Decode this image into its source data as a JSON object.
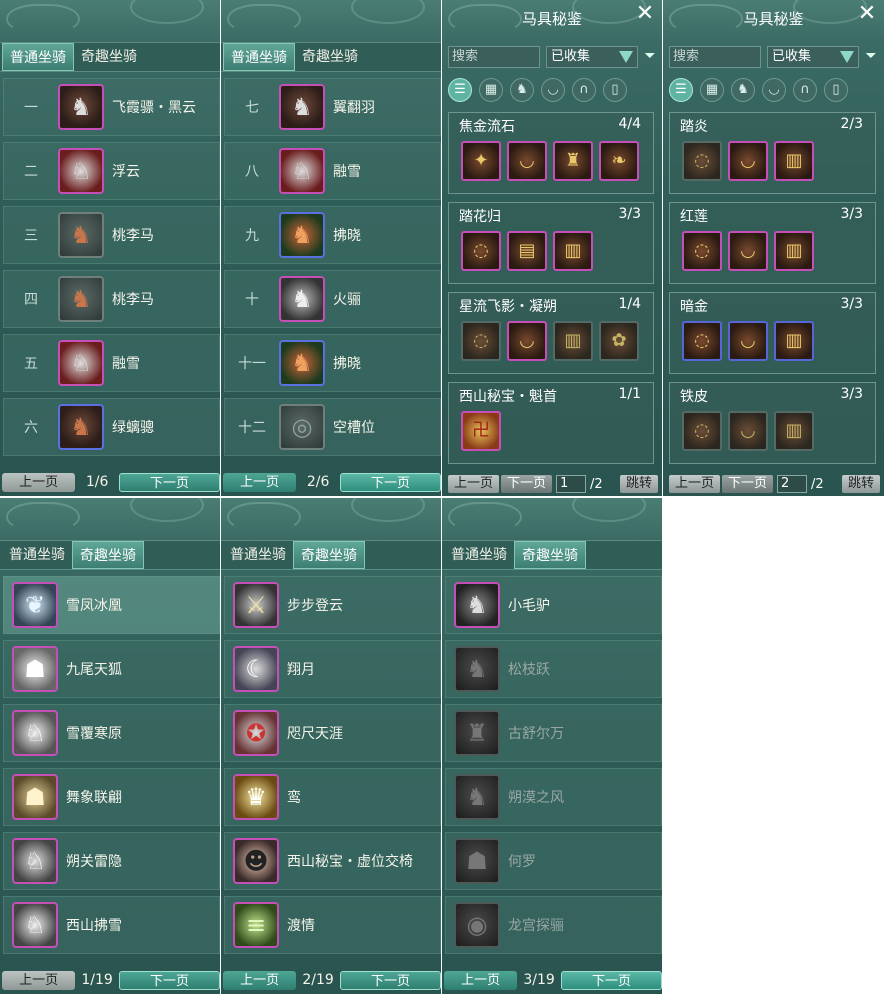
{
  "colors": {
    "panel_bg": "#2f5d57",
    "tab_active": "#4b9485",
    "rare_border": "#c44fb6",
    "epic_border": "#5a6fe0",
    "next_button": "#3aa08f"
  },
  "tabs": {
    "normal": "普通坐骑",
    "fun": "奇趣坐骑"
  },
  "pager": {
    "prev": "上一页",
    "next": "下一页"
  },
  "normal_page1": {
    "page": "1/6",
    "items": [
      {
        "num": "一",
        "name": "飞霞骠・黑云",
        "icon": "black-horse-icon"
      },
      {
        "num": "二",
        "name": "浮云",
        "icon": "white-horse-icon"
      },
      {
        "num": "三",
        "name": "桃李马",
        "icon": "brown-horse-icon"
      },
      {
        "num": "四",
        "name": "桃李马",
        "icon": "brown-horse-icon"
      },
      {
        "num": "五",
        "name": "融雪",
        "icon": "white-horse-icon"
      },
      {
        "num": "六",
        "name": "绿螭骢",
        "icon": "brown-horse-icon"
      }
    ]
  },
  "normal_page2": {
    "page": "2/6",
    "items": [
      {
        "num": "七",
        "name": "翼翻羽",
        "icon": "black-horse-icon"
      },
      {
        "num": "八",
        "name": "融雪",
        "icon": "white-horse-icon"
      },
      {
        "num": "九",
        "name": "拂晓",
        "icon": "chestnut-horse-icon"
      },
      {
        "num": "十",
        "name": "火骊",
        "icon": "gray-horse-icon"
      },
      {
        "num": "十一",
        "name": "拂晓",
        "icon": "chestnut-horse-icon"
      },
      {
        "num": "十二",
        "name": "空槽位",
        "icon": "empty-slot-icon"
      }
    ]
  },
  "catalog_common": {
    "title": "马具秘鉴",
    "search_placeholder": "搜索",
    "filter_value": "已收集",
    "page_total": "/2",
    "jump": "跳转"
  },
  "catalog1": {
    "page_value": "1",
    "sets": [
      {
        "name": "焦金流石",
        "count": "4/4"
      },
      {
        "name": "踏花归",
        "count": "3/3"
      },
      {
        "name": "星流飞影・凝朔",
        "count": "1/4"
      },
      {
        "name": "西山秘宝・魁首",
        "count": "1/1"
      }
    ]
  },
  "catalog2": {
    "page_value": "2",
    "sets": [
      {
        "name": "踏炎",
        "count": "2/3"
      },
      {
        "name": "红莲",
        "count": "3/3"
      },
      {
        "name": "暗金",
        "count": "3/3"
      },
      {
        "name": "铁皮",
        "count": "3/3"
      }
    ]
  },
  "fun_page1": {
    "page": "1/19",
    "items": [
      "雪凤冰凰",
      "九尾天狐",
      "雪覆寒原",
      "舞象联翩",
      "朔关雷隐",
      "西山拂雪"
    ]
  },
  "fun_page2": {
    "page": "2/19",
    "items": [
      "步步登云",
      "翔月",
      "咫尺天涯",
      "鸾",
      "西山秘宝・虚位交椅",
      "渡情"
    ]
  },
  "fun_page3": {
    "page": "3/19",
    "items": [
      "小毛驴",
      "松枝跃",
      "古舒尔万",
      "朔漠之风",
      "何罗",
      "龙宫探骊"
    ]
  }
}
